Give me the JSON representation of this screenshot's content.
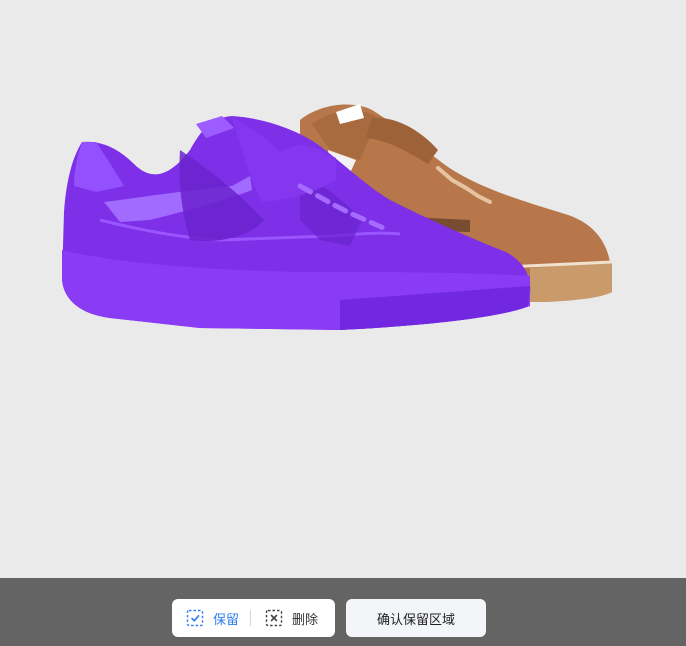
{
  "toolbar": {
    "keep_label": "保留",
    "delete_label": "删除",
    "confirm_label": "确认保留区域",
    "keep_icon": "select-keep-icon",
    "delete_icon": "select-delete-icon",
    "active_mode": "keep"
  },
  "colors": {
    "canvas_bg": "#eaeaea",
    "toolbar_bg": "#646464",
    "accent": "#2f7df0",
    "selection_mask": "#8a3cf5"
  }
}
